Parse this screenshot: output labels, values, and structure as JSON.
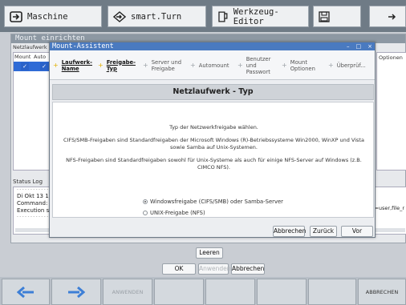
{
  "topbar": {
    "tabs": [
      {
        "label": "Maschine",
        "icon": "machine-icon"
      },
      {
        "label": "smart.Turn",
        "icon": "smart-turn-icon"
      },
      {
        "label": "Werkzeug-Editor",
        "icon": "tool-editor-icon"
      },
      {
        "label": "",
        "icon": "save-icon"
      },
      {
        "label": "",
        "icon": "arrow-icon"
      }
    ]
  },
  "background_window": {
    "title": "Mount einrichten",
    "netzlaufwerk_label": "Netzlaufwerk",
    "grid_headers": [
      "Mount",
      "Auto"
    ],
    "options_header": "Optionen",
    "status_label": "Status Log",
    "log_lines": [
      "Di Okt 13 1",
      "Command:",
      "Execution s"
    ],
    "log_right": "=user,file_r",
    "leeren_label": "Leeren"
  },
  "dialog_buttons": {
    "ok": "OK",
    "anwenden": "Anwenden",
    "abbrechen": "Abbrechen"
  },
  "softkeys": {
    "anwenden": "ANWENDEN",
    "abbrechen": "ABBRECHEN"
  },
  "wizard": {
    "title": "Mount-Assistent",
    "controls": [
      "–",
      "□",
      "×"
    ],
    "steps": [
      {
        "label": "Laufwerk-\nName",
        "state": "done"
      },
      {
        "label": "Freigabe-\nTyp",
        "state": "active"
      },
      {
        "label": "Server und\nFreigabe",
        "state": "pending"
      },
      {
        "label": "Automount",
        "state": "pending"
      },
      {
        "label": "Benutzer\nund\nPasswort",
        "state": "pending"
      },
      {
        "label": "Mount\nOptionen",
        "state": "pending"
      },
      {
        "label": "Überprüf...",
        "state": "pending"
      }
    ],
    "heading": "Netzlaufwerk - Typ",
    "intro": "Typ der Netzwerkfreigabe wählen.",
    "cifs_text": "CIFS/SMB-Freigaben sind Standardfreigaben der Microsoft Windows (R)-Betriebssysteme Win2000, WinXP und Vista sowie Samba auf Unix-Systemen.",
    "nfs_text": "NFS-Freigaben sind Standardfreigaben sowohl für Unix-Systeme als auch für einige NFS-Server auf Windows (z.B. CIMCO NFS).",
    "options": [
      {
        "label": "Windowsfreigabe (CIFS/SMB) oder Samba-Server",
        "selected": true
      },
      {
        "label": "UNIX-Freigabe (NFS)",
        "selected": false
      }
    ],
    "buttons": {
      "abbrechen": "Abbrechen",
      "zurueck": "Zurück",
      "vor": "Vor"
    }
  },
  "colors": {
    "wizard_title_bg": "#4a7ac0",
    "step_active_marker": "#e0b000",
    "selection_blue": "#2f6bd6",
    "topbar_bg": "#6f7b86"
  }
}
